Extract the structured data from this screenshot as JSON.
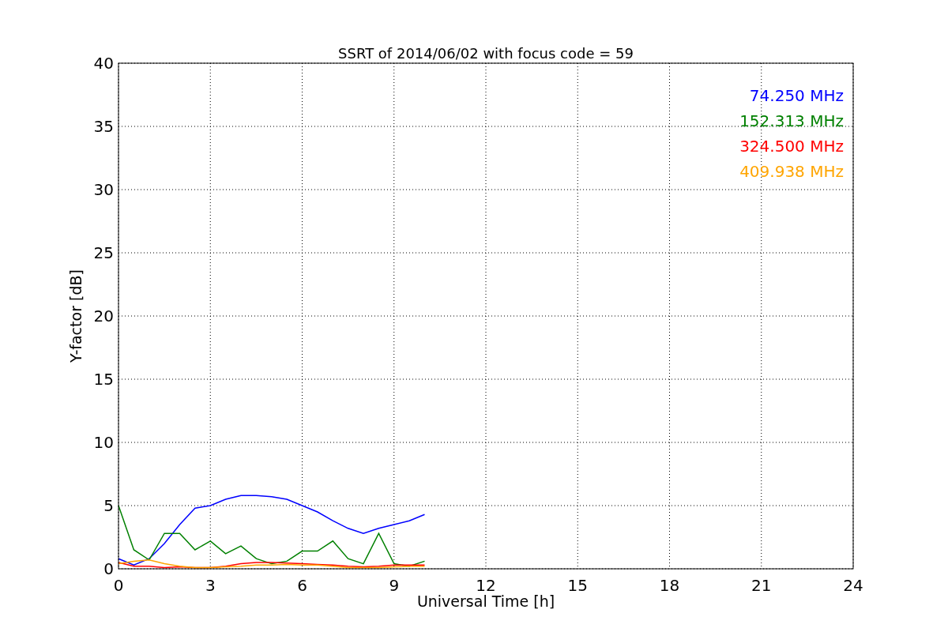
{
  "chart_data": {
    "type": "line",
    "title": "SSRT of 2014/06/02 with focus code = 59",
    "xlabel": "Universal Time [h]",
    "ylabel": "Y-factor [dB]",
    "x": [
      0,
      0.5,
      1,
      1.5,
      2,
      2.5,
      3,
      3.5,
      4,
      4.5,
      5,
      5.5,
      6,
      6.5,
      7,
      7.5,
      8,
      8.5,
      9,
      9.5,
      10
    ],
    "series": [
      {
        "name": "74.250 MHz",
        "color": "#0000ff",
        "values": [
          0.8,
          0.3,
          0.8,
          2,
          3.5,
          4.8,
          5,
          5.5,
          5.8,
          5.8,
          5.7,
          5.5,
          5,
          4.5,
          3.8,
          3.2,
          2.8,
          3.2,
          3.5,
          3.8,
          4.3
        ]
      },
      {
        "name": "152.313 MHz",
        "color": "#008000",
        "values": [
          5,
          1.5,
          0.7,
          2.8,
          2.8,
          1.5,
          2.2,
          1.2,
          1.8,
          0.8,
          0.4,
          0.6,
          1.4,
          1.4,
          2.2,
          0.8,
          0.4,
          2.8,
          0.4,
          0.2,
          0.6
        ]
      },
      {
        "name": "324.500 MHz",
        "color": "#ff0000",
        "values": [
          0.5,
          0.2,
          0.2,
          0.1,
          0.15,
          0.1,
          0.1,
          0.2,
          0.4,
          0.5,
          0.5,
          0.45,
          0.4,
          0.35,
          0.3,
          0.2,
          0.15,
          0.2,
          0.3,
          0.3,
          0.3
        ]
      },
      {
        "name": "409.938 MHz",
        "color": "#ffa500",
        "values": [
          0.4,
          0.6,
          0.7,
          0.4,
          0.2,
          0.1,
          0.1,
          0.15,
          0.2,
          0.3,
          0.3,
          0.35,
          0.3,
          0.3,
          0.2,
          0.1,
          0.1,
          0.1,
          0.15,
          0.2,
          0.2
        ]
      }
    ],
    "grid": true,
    "xlim": [
      0,
      24
    ],
    "ylim": [
      0,
      40
    ],
    "xticks": [
      0,
      3,
      6,
      9,
      12,
      15,
      18,
      21,
      24
    ],
    "yticks": [
      0,
      5,
      10,
      15,
      20,
      25,
      30,
      35,
      40
    ]
  }
}
